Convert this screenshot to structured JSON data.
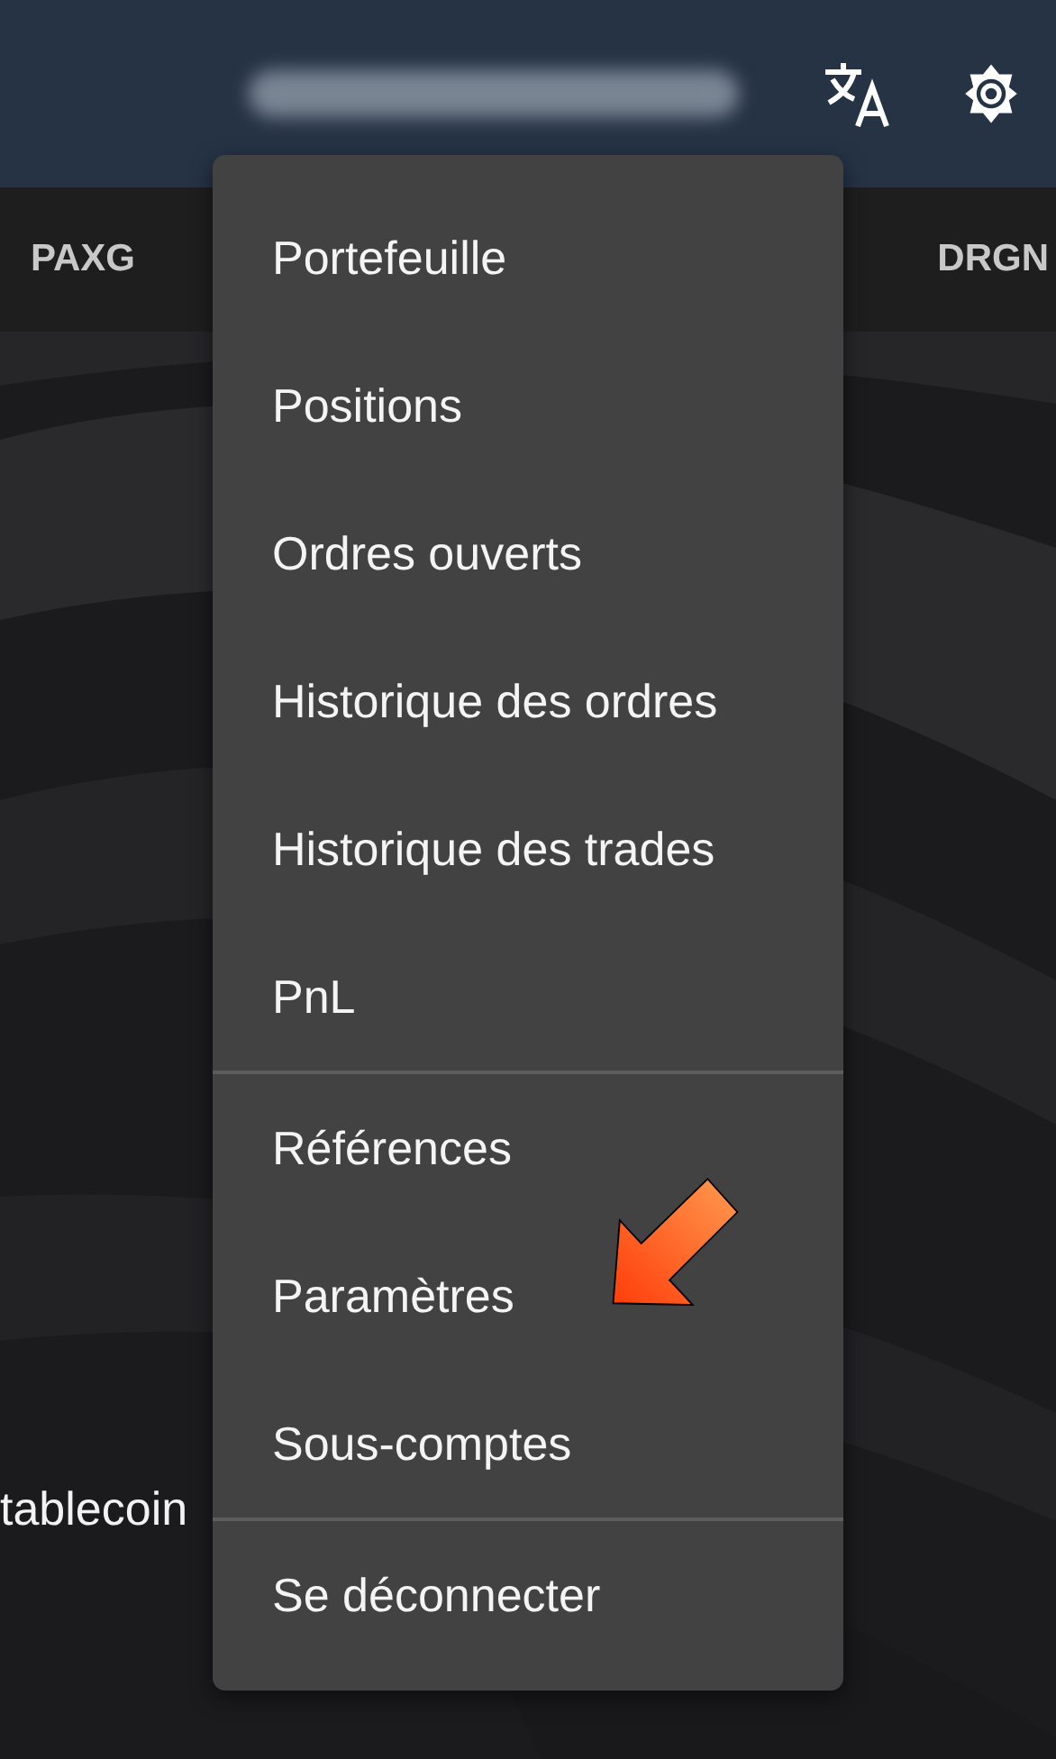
{
  "tabs": [
    {
      "label": "PAXG"
    },
    {
      "label": "DRGN"
    }
  ],
  "background_text": "tablecoin",
  "menu": {
    "sections": [
      {
        "items": [
          "Portefeuille",
          "Positions",
          "Ordres ouverts",
          "Historique des ordres",
          "Historique des trades",
          "PnL"
        ]
      },
      {
        "items": [
          "Références",
          "Paramètres",
          "Sous-comptes"
        ]
      },
      {
        "items": [
          "Se déconnecter"
        ]
      }
    ]
  }
}
